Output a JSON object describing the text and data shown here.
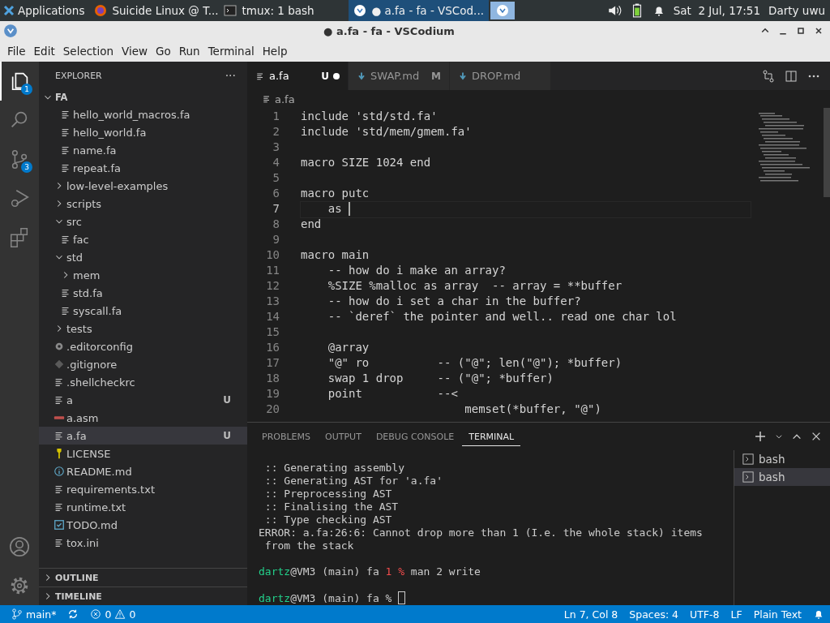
{
  "taskbar": {
    "apps_label": "Applications",
    "windows": [
      {
        "title": "Suicide Linux @ T...",
        "kind": "browser",
        "selected": false
      },
      {
        "title": "tmux: 1 bash",
        "kind": "terminal",
        "selected": false
      },
      {
        "title": "● a.fa - fa - VSCod...",
        "kind": "editor",
        "selected": true
      }
    ],
    "clock": "Sat  2 Jul, 17:51",
    "user": "Darty uwu"
  },
  "window": {
    "title": "● a.fa - fa - VSCodium"
  },
  "menu": [
    "File",
    "Edit",
    "Selection",
    "View",
    "Go",
    "Run",
    "Terminal",
    "Help"
  ],
  "activity_bar": [
    {
      "kind": "explorer",
      "badge": "1",
      "selected": true
    },
    {
      "kind": "search",
      "selected": false
    },
    {
      "kind": "source-control",
      "badge": "3",
      "selected": false
    },
    {
      "kind": "debug",
      "selected": false
    },
    {
      "kind": "extensions",
      "selected": false
    }
  ],
  "explorer": {
    "title": "EXPLORER",
    "more": "···",
    "root": {
      "label": "FA",
      "expanded": true,
      "children": [
        {
          "children": [
            {
              "label": "hello_world_macros.fa",
              "kind": "text-file",
              "selected": false
            },
            {
              "label": "hello_world.fa",
              "kind": "text-file",
              "selected": false
            },
            {
              "label": "name.fa",
              "kind": "text-file",
              "selected": false
            },
            {
              "label": "repeat.fa",
              "kind": "text-file",
              "selected": false
            }
          ]
        },
        {
          "label": "low-level-examples",
          "kind": "folder",
          "expanded": false,
          "selected": false
        },
        {
          "label": "scripts",
          "kind": "folder",
          "expanded": false,
          "selected": false
        },
        {
          "label": "src",
          "kind": "folder",
          "expanded": true,
          "selected": false,
          "children": [
            {
              "label": "fac",
              "kind": "text-file",
              "selected": false
            }
          ]
        },
        {
          "label": "std",
          "kind": "folder",
          "expanded": true,
          "selected": false,
          "children": [
            {
              "label": "mem",
              "kind": "folder",
              "expanded": false,
              "selected": false
            },
            {
              "label": "std.fa",
              "kind": "text-file",
              "selected": false
            },
            {
              "label": "syscall.fa",
              "kind": "text-file",
              "selected": false
            }
          ]
        },
        {
          "label": "tests",
          "kind": "folder",
          "expanded": false,
          "selected": false
        },
        {
          "label": ".editorconfig",
          "kind": "config-file",
          "selected": false
        },
        {
          "label": ".gitignore",
          "kind": "git-file",
          "selected": false
        },
        {
          "label": ".shellcheckrc",
          "kind": "text-file",
          "selected": false
        },
        {
          "label": "a",
          "kind": "text-file",
          "status": "U",
          "selected": false
        },
        {
          "label": "a.asm",
          "kind": "asm-file",
          "selected": false
        },
        {
          "label": "a.fa",
          "kind": "text-file",
          "status": "U",
          "selected": true
        },
        {
          "label": "LICENSE",
          "kind": "license-file",
          "selected": false
        },
        {
          "label": "README.md",
          "kind": "info-file",
          "selected": false
        },
        {
          "label": "requirements.txt",
          "kind": "text-file",
          "selected": false
        },
        {
          "label": "runtime.txt",
          "kind": "text-file",
          "selected": false
        },
        {
          "label": "TODO.md",
          "kind": "todo-file",
          "selected": false
        },
        {
          "label": "tox.ini",
          "kind": "text-file",
          "selected": false
        }
      ]
    },
    "sections": [
      {
        "label": "OUTLINE",
        "expanded": false
      },
      {
        "label": "TIMELINE",
        "expanded": false
      }
    ]
  },
  "tabs": [
    {
      "label": "a.fa",
      "kind": "text",
      "status": "U",
      "dirty": true,
      "selected": true
    },
    {
      "label": "SWAP.md",
      "kind": "markdown",
      "status": "M",
      "dirty": false,
      "selected": false
    },
    {
      "label": "DROP.md",
      "kind": "markdown",
      "dirty": false,
      "selected": false
    }
  ],
  "breadcrumb": "a.fa",
  "code": [
    {
      "number": "1",
      "text": "include 'std/std.fa'",
      "current": false
    },
    {
      "number": "2",
      "text": "include 'std/mem/gmem.fa'",
      "current": false
    },
    {
      "number": "3",
      "current": false
    },
    {
      "number": "4",
      "text": "macro SIZE 1024 end",
      "current": false
    },
    {
      "number": "5",
      "current": false
    },
    {
      "number": "6",
      "text": "macro putc",
      "current": false
    },
    {
      "number": "7",
      "text": "    as ",
      "current": true
    },
    {
      "number": "8",
      "text": "end",
      "current": false
    },
    {
      "number": "9",
      "current": false
    },
    {
      "number": "10",
      "text": "macro main",
      "current": false
    },
    {
      "number": "11",
      "text": "    -- how do i make an array?",
      "current": false
    },
    {
      "number": "12",
      "text": "    %SIZE %malloc as array  -- array = **buffer",
      "current": false
    },
    {
      "number": "13",
      "text": "    -- how do i set a char in the buffer?",
      "current": false
    },
    {
      "number": "14",
      "text": "    -- `deref` the pointer and well.. read one char lol",
      "current": false
    },
    {
      "number": "15",
      "current": false
    },
    {
      "number": "16",
      "text": "    @array",
      "current": false
    },
    {
      "number": "17",
      "text": "    \"@\" ro          -- (\"@\"; len(\"@\"); *buffer)",
      "current": false
    },
    {
      "number": "18",
      "text": "    swap 1 drop     -- (\"@\"; *buffer)",
      "current": false
    },
    {
      "number": "19",
      "text": "    point           --<",
      "current": false
    },
    {
      "number": "20",
      "text": "                        memset(*buffer, \"@\")",
      "current": false
    }
  ],
  "panel": {
    "tabs": [
      {
        "label": "PROBLEMS",
        "selected": false
      },
      {
        "label": "OUTPUT",
        "selected": false
      },
      {
        "label": "DEBUG CONSOLE",
        "selected": false
      },
      {
        "label": "TERMINAL",
        "selected": true
      }
    ],
    "terminal": [
      {
        "lines": [
          [
            {
              "text": " :: Generating assembly",
              "kind": "plain"
            }
          ],
          [
            {
              "text": " :: Generating AST for 'a.fa'",
              "kind": "plain"
            }
          ],
          [
            {
              "text": " :: Preprocessing AST",
              "kind": "plain"
            }
          ],
          [
            {
              "text": " :: Finalising the AST",
              "kind": "plain"
            }
          ],
          [
            {
              "text": " :: Type checking AST",
              "kind": "plain"
            }
          ],
          [
            {
              "text": "ERROR: a.fa:26:6: Cannot drop more than 1 (I.e. the whole stack) items",
              "kind": "plain"
            }
          ],
          [
            {
              "text": " from the stack",
              "kind": "plain"
            }
          ]
        ]
      },
      {
        "lines": [
          [
            {
              "text": "dartz",
              "kind": "user"
            },
            {
              "text": "@VM3 (main) fa ",
              "kind": "plain"
            },
            {
              "text": "1 %",
              "kind": "status"
            },
            {
              "text": " man 2 write",
              "kind": "plain"
            }
          ]
        ]
      },
      {
        "lines": [
          [
            {
              "text": "dartz",
              "kind": "user"
            },
            {
              "text": "@VM3 (main) fa % ",
              "kind": "plain"
            },
            {
              "kind": "cursor"
            }
          ]
        ]
      }
    ],
    "shells": [
      {
        "label": "bash",
        "selected": false
      },
      {
        "label": "bash",
        "selected": true
      }
    ]
  },
  "status_bar": {
    "branch": "main*",
    "errors": "0",
    "warnings": "0",
    "right": [
      "Ln 7, Col 8",
      "Spaces: 4",
      "UTF-8",
      "LF",
      "Plain Text"
    ]
  }
}
